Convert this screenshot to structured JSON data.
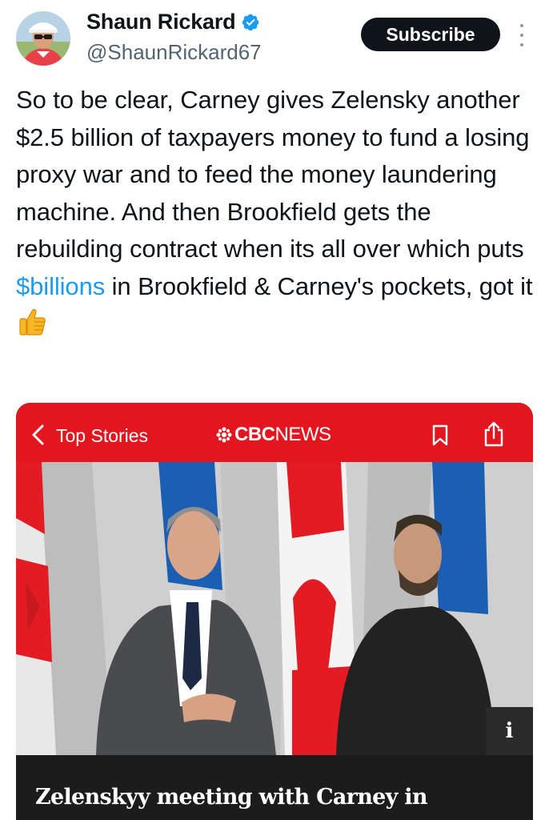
{
  "post": {
    "author": {
      "display_name": "Shaun Rickard",
      "handle": "@ShaunRickard67",
      "verified": true
    },
    "subscribe_label": "Subscribe",
    "more_icon": "more-vertical-icon",
    "text": {
      "part1": "So to be clear, Carney gives Zelensky another $2.5 billion of taxpayers money to fund a losing proxy war and to feed the money laundering machine. And then Brookfield gets the rebuilding contract when its all over which puts ",
      "cashtag": "$billions",
      "part2": " in Brookfield & Carney's pockets, got it ",
      "emoji": "thumbs-up-icon"
    }
  },
  "embedded_card": {
    "back_label": "Top Stories",
    "brand_bold": "CBC",
    "brand_light": "NEWS",
    "headline": "Zelenskyy meeting with Carney in",
    "info_label": "i",
    "colors": {
      "brand_red": "#e3161f",
      "cashtag_blue": "#1d9bf0"
    }
  }
}
